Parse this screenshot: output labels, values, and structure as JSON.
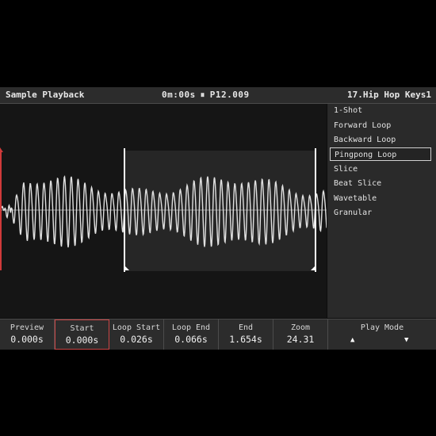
{
  "header": {
    "title": "Sample Playback",
    "time": "0m:00s",
    "pause_symbol": "⏸",
    "position": "P12.009",
    "preset": "17.Hip Hop Keys1"
  },
  "play_modes": {
    "items": [
      "1-Shot",
      "Forward Loop",
      "Backward Loop",
      "Pingpong Loop",
      "Slice",
      "Beat Slice",
      "Wavetable",
      "Granular"
    ],
    "selected_index": 3
  },
  "params": [
    {
      "label": "Preview",
      "value": "0.000s"
    },
    {
      "label": "Start",
      "value": "0.000s"
    },
    {
      "label": "Loop Start",
      "value": "0.026s"
    },
    {
      "label": "Loop End",
      "value": "0.066s"
    },
    {
      "label": "End",
      "value": "1.654s"
    },
    {
      "label": "Zoom",
      "value": "24.31"
    }
  ],
  "play_mode_param": {
    "label": "Play Mode",
    "up_arrow": "▲",
    "down_arrow": "▼"
  },
  "colors": {
    "start_marker": "#d03a3a",
    "loop_marker": "#ffffff",
    "waveform": "#e0e0e0",
    "active_param_border": "#c94545"
  }
}
